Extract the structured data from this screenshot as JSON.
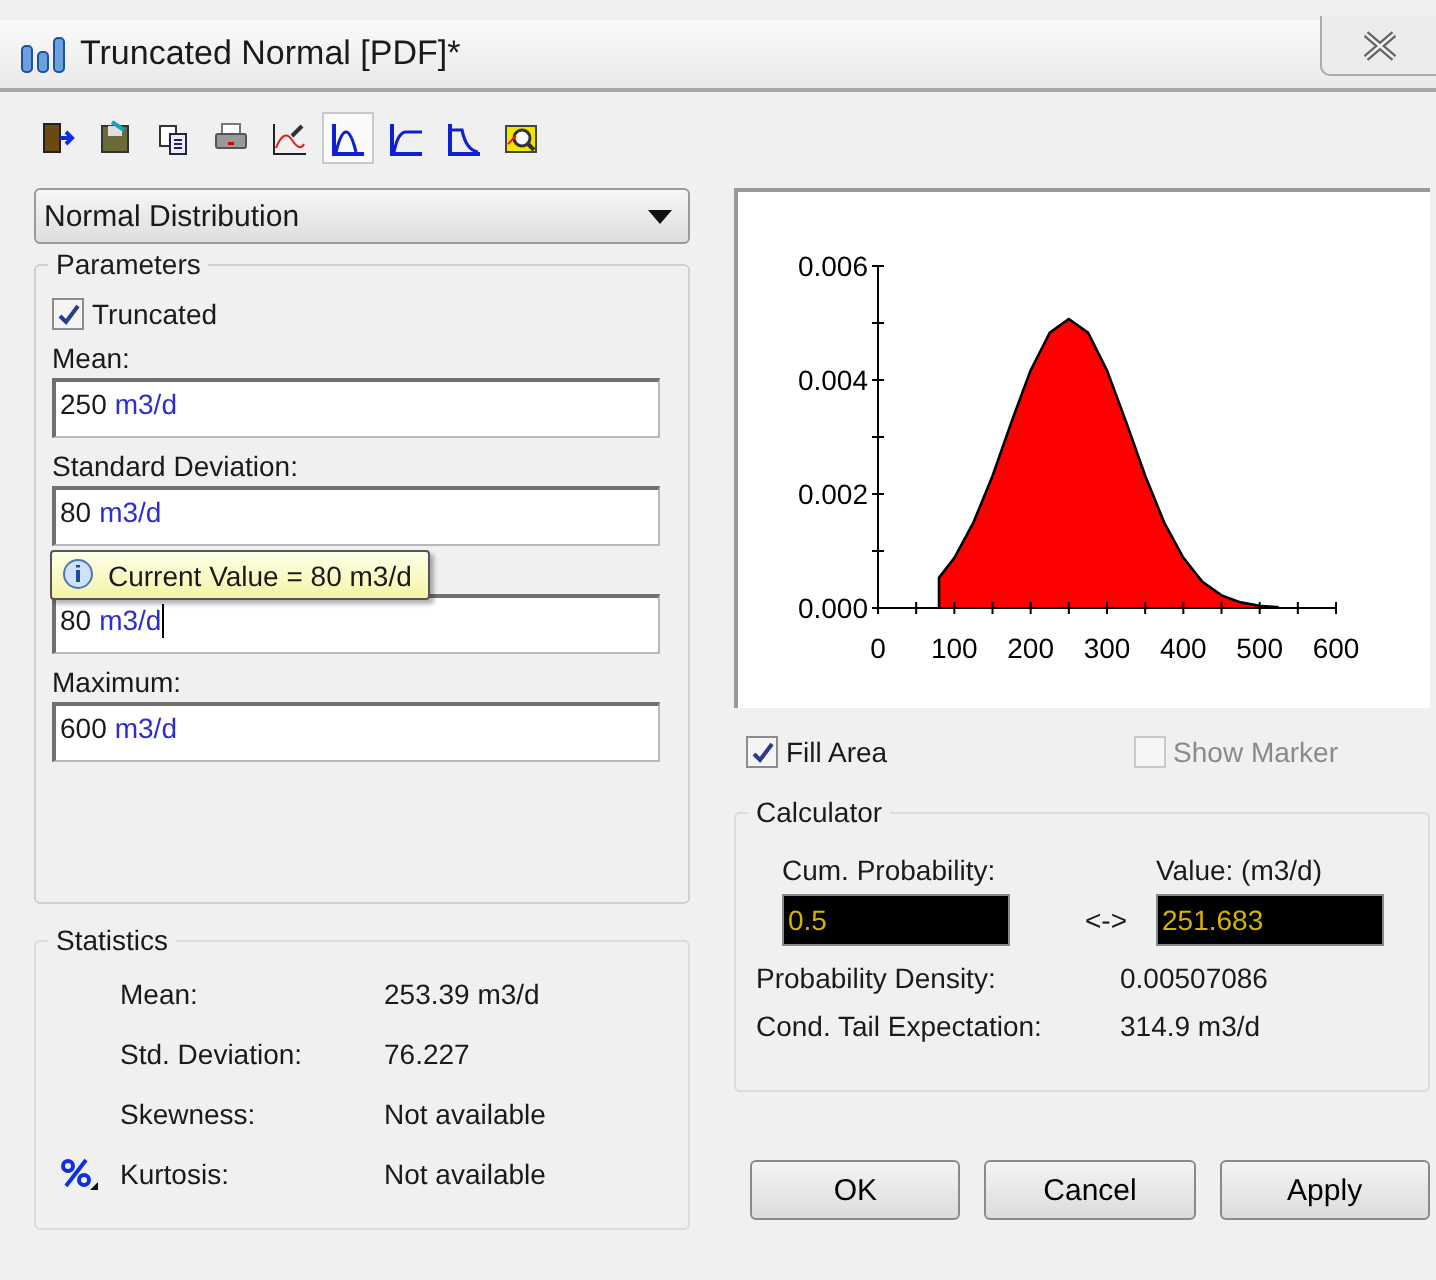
{
  "window": {
    "title": "Truncated Normal [PDF]*"
  },
  "toolbar": [
    {
      "kind": "exit",
      "selected": false
    },
    {
      "kind": "save",
      "selected": false
    },
    {
      "kind": "copy",
      "selected": false
    },
    {
      "kind": "print",
      "selected": false
    },
    {
      "kind": "chart",
      "selected": false
    },
    {
      "kind": "pdf",
      "selected": true
    },
    {
      "kind": "cdf",
      "selected": false
    },
    {
      "kind": "survival",
      "selected": false
    },
    {
      "kind": "zoom",
      "selected": false
    }
  ],
  "distribution": {
    "value": "Normal Distribution"
  },
  "parameters": {
    "title": "Parameters",
    "truncated": {
      "label": "Truncated",
      "checked": true,
      "disabled": false
    },
    "fields": [
      {
        "label": "Mean:",
        "value": "250",
        "unit": "m3/d",
        "focused": false
      },
      {
        "label": "Standard Deviation:",
        "value": "80",
        "unit": "m3/d",
        "focused": false
      },
      {
        "value": "80",
        "unit": "m3/d",
        "focused": true
      },
      {
        "label": "Maximum:",
        "value": "600",
        "unit": "m3/d",
        "focused": false
      }
    ],
    "tooltip": {
      "text": "Current Value = 80 m3/d"
    }
  },
  "statistics": {
    "title": "Statistics",
    "rows": [
      {
        "label": "Mean:",
        "value": "253.39 m3/d"
      },
      {
        "label": "Std. Deviation:",
        "value": "76.227"
      },
      {
        "label": "Skewness:",
        "value": "Not available"
      },
      {
        "label": "Kurtosis:",
        "value": "Not available"
      }
    ]
  },
  "chart": {
    "chart_data": {
      "type": "area",
      "x": [
        80,
        100,
        125,
        150,
        175,
        200,
        225,
        250,
        275,
        300,
        325,
        350,
        375,
        400,
        425,
        450,
        475,
        500,
        525
      ],
      "series": [
        {
          "color": "#ff0000",
          "values": [
            0.00053,
            0.00088,
            0.0015,
            0.00232,
            0.00327,
            0.00417,
            0.00483,
            0.00507,
            0.00483,
            0.00417,
            0.00327,
            0.00232,
            0.0015,
            0.00088,
            0.00046,
            0.00022,
            0.0001,
            4e-05,
            1e-05
          ]
        }
      ],
      "xlim": [
        0,
        600
      ],
      "ylim": [
        0,
        0.006
      ],
      "xticks": [
        0,
        100,
        200,
        300,
        400,
        500,
        600
      ],
      "yticks": [
        {
          "value": 0,
          "label": "0.000"
        },
        {
          "value": 0.002,
          "label": "0.002"
        },
        {
          "value": 0.004,
          "label": "0.004"
        },
        {
          "value": 0.006,
          "label": "0.006"
        }
      ]
    }
  },
  "fill_area": {
    "label": "Fill Area",
    "checked": true,
    "disabled": false
  },
  "show_marker": {
    "label": "Show Marker",
    "checked": false,
    "disabled": true
  },
  "calculator": {
    "title": "Calculator",
    "cum_probability": {
      "label": "Cum. Probability:",
      "value": "0.5"
    },
    "swap": "<->",
    "result": {
      "label": "Value: (m3/d)",
      "value": "251.683"
    },
    "rows": [
      {
        "label": "Probability Density:",
        "value": "0.00507086"
      },
      {
        "label": "Cond. Tail Expectation:",
        "value": "314.9 m3/d"
      }
    ]
  },
  "buttons": [
    "OK",
    "Cancel",
    "Apply"
  ]
}
